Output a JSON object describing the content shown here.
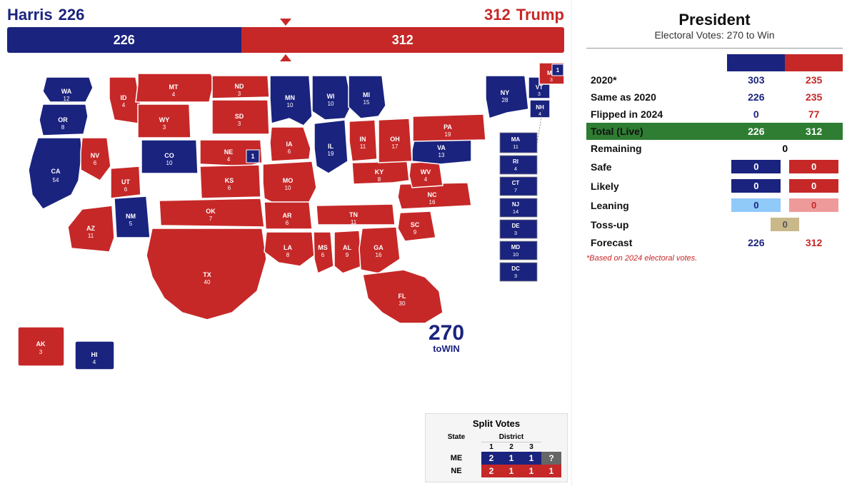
{
  "header": {
    "harris_label": "Harris",
    "harris_votes": "226",
    "trump_votes": "312",
    "trump_label": "Trump"
  },
  "progress": {
    "blue_votes": "226",
    "red_votes": "312",
    "blue_pct": 42,
    "red_pct": 58
  },
  "panel": {
    "title": "President",
    "subtitle": "Electoral Votes: 270 to Win",
    "stats": [
      {
        "label": "2020*",
        "blue": "303",
        "red": "235"
      },
      {
        "label": "Same as 2020",
        "blue": "226",
        "red": "235"
      },
      {
        "label": "Flipped in 2024",
        "blue": "0",
        "red": "77"
      },
      {
        "label": "Total (Live)",
        "blue": "226",
        "red": "312",
        "highlight": true
      },
      {
        "label": "Remaining",
        "single": "0"
      },
      {
        "label": "Safe",
        "blue": "0",
        "red": "0",
        "colored": true
      },
      {
        "label": "Likely",
        "blue": "0",
        "red": "0",
        "colored": true
      },
      {
        "label": "Leaning",
        "blue": "0",
        "red": "0",
        "light": true
      },
      {
        "label": "Toss-up",
        "single": "0",
        "tan": true
      },
      {
        "label": "Forecast",
        "blue": "226",
        "red": "312"
      }
    ],
    "footnote": "*Based on 2024 electoral votes."
  },
  "inset_states": [
    {
      "abbr": "MA",
      "votes": "11",
      "color": "blue"
    },
    {
      "abbr": "RI",
      "votes": "4",
      "color": "blue"
    },
    {
      "abbr": "CT",
      "votes": "7",
      "color": "blue"
    },
    {
      "abbr": "NJ",
      "votes": "14",
      "color": "blue"
    },
    {
      "abbr": "DE",
      "votes": "3",
      "color": "blue"
    },
    {
      "abbr": "MD",
      "votes": "10",
      "color": "blue"
    },
    {
      "abbr": "DC",
      "votes": "3",
      "color": "blue"
    }
  ],
  "split_votes": {
    "title": "Split Votes",
    "headers": {
      "state": "State",
      "d1": "1",
      "d2": "2",
      "d3": "3",
      "district": "District"
    },
    "rows": [
      {
        "state": "ME",
        "at_large": "2",
        "d1": "1",
        "d2": "1",
        "d3": "?",
        "d1_color": "blue",
        "d2_color": "blue",
        "d3_color": "unknown",
        "at_color": "blue"
      },
      {
        "state": "NE",
        "at_large": "2",
        "d1": "1",
        "d2": "1",
        "d3": "1",
        "d1_color": "red",
        "d2_color": "red",
        "d3_color": "red",
        "at_color": "red"
      }
    ]
  },
  "logo": {
    "num": "270",
    "text": "toWIN"
  },
  "states": {
    "WA": "12",
    "OR": "8",
    "CA": "54",
    "NV": "6",
    "ID": "4",
    "MT": "4",
    "WY": "3",
    "UT": "6",
    "AZ": "11",
    "CO": "10",
    "NM": "5",
    "ND": "3",
    "SD": "3",
    "NE": "4",
    "KS": "6",
    "OK": "7",
    "TX": "40",
    "MN": "10",
    "IA": "6",
    "MO": "10",
    "AR": "6",
    "LA": "8",
    "WI": "10",
    "IL": "19",
    "MS": "6",
    "AL": "9",
    "MI": "15",
    "IN": "11",
    "TN": "11",
    "KY": "8",
    "OH": "17",
    "GA": "16",
    "SC": "9",
    "NC": "16",
    "WV": "4",
    "VA": "13",
    "PA": "19",
    "NY": "28",
    "VT": "3",
    "NH": "4",
    "ME": "3",
    "FL": "30",
    "HI": "4",
    "AK": "3"
  }
}
